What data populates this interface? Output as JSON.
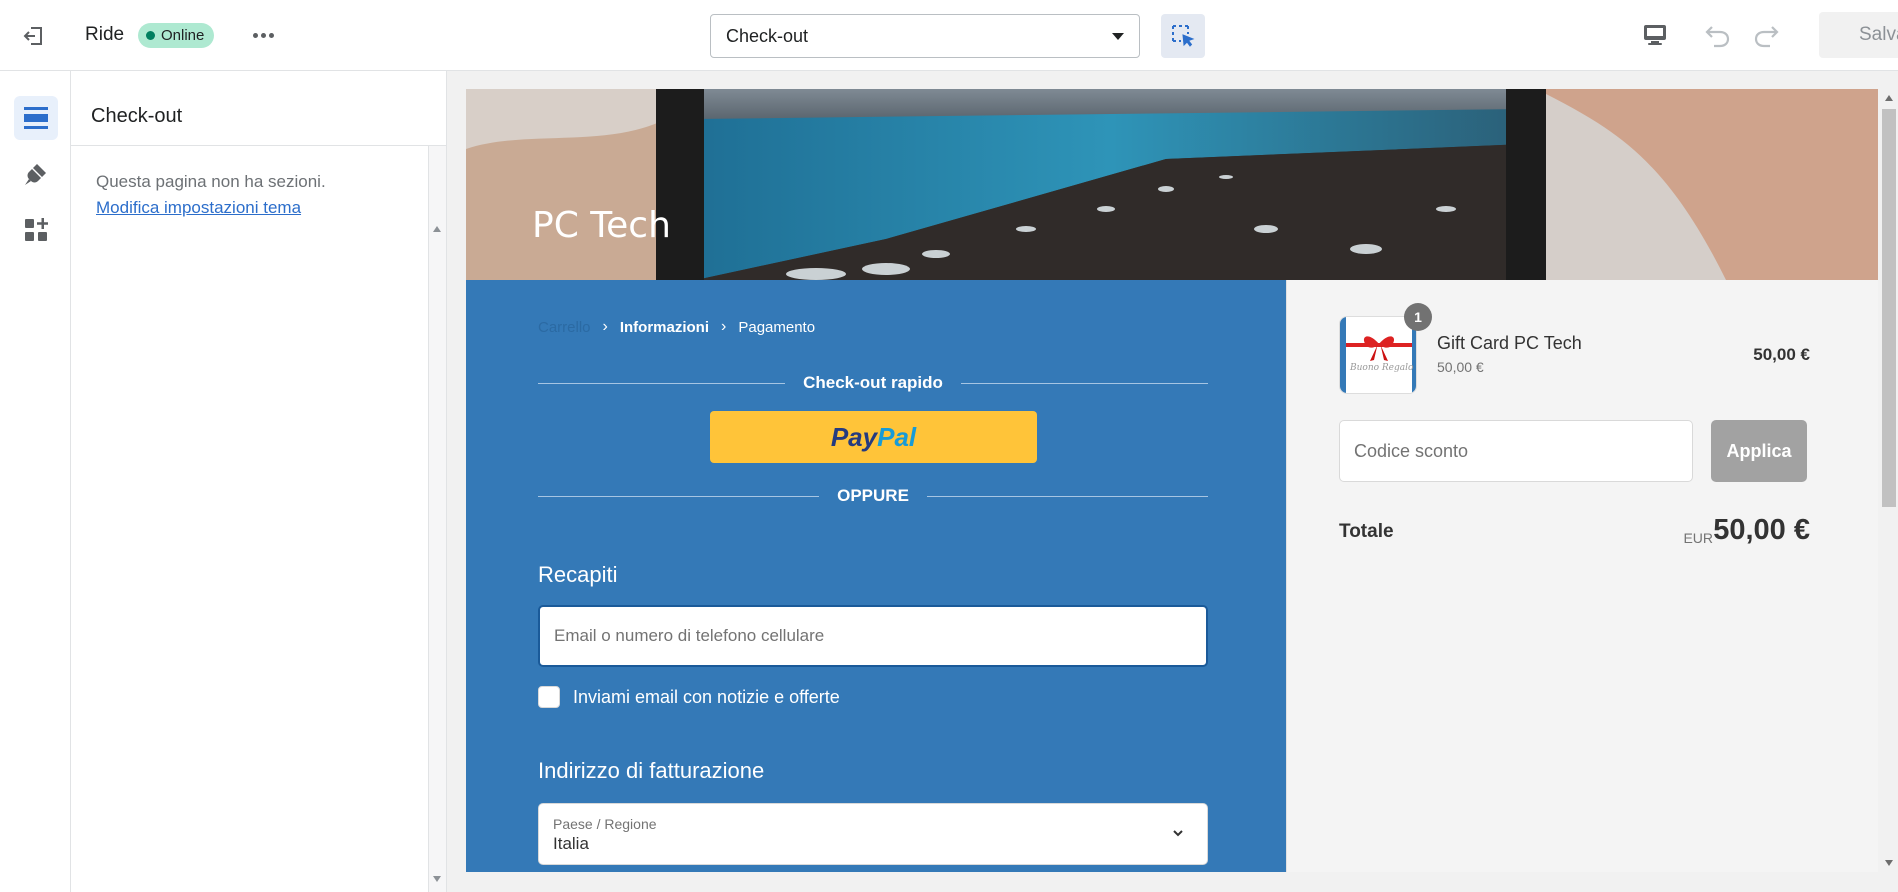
{
  "topbar": {
    "store_name": "Ride",
    "status_badge": "Online",
    "template_select": "Check-out",
    "save_label": "Salva"
  },
  "sidebar": {
    "title": "Check-out",
    "empty_message": "Questa pagina non ha sezioni.",
    "theme_settings_link": "Modifica impostazioni tema"
  },
  "preview": {
    "shop_name": "PC Tech",
    "breadcrumbs": [
      "Carrello",
      "Informazioni",
      "Pagamento"
    ],
    "express_checkout_title": "Check-out rapido",
    "paypal_label": {
      "pay": "Pay",
      "pal": "Pal"
    },
    "or_divider": "OPPURE",
    "contact_heading": "Recapiti",
    "email_placeholder": "Email o numero di telefono cellulare",
    "newsletter_label": "Inviami email con notizie e offerte",
    "billing_heading": "Indirizzo di fatturazione",
    "country_label": "Paese / Regione",
    "country_value": "Italia",
    "cart": {
      "item_quantity": "1",
      "item_name": "Gift Card PC Tech",
      "item_variant_price": "50,00 €",
      "item_price": "50,00 €",
      "thumb_text": "Buono Regalo",
      "discount_placeholder": "Codice sconto",
      "apply_label": "Applica",
      "total_label": "Totale",
      "total_currency": "EUR",
      "total_amount": "50,00 €"
    }
  },
  "colors": {
    "checkout_main_bg": "#3479b7",
    "badge_online_bg": "#aee9d1",
    "paypal_yellow": "#ffc439",
    "link_blue": "#2c6ecb"
  },
  "icons": [
    "exit-icon",
    "more-dots-icon",
    "dropdown-caret-icon",
    "inspect-icon",
    "desktop-icon",
    "undo-icon",
    "redo-icon",
    "sections-icon",
    "theme-brush-icon",
    "apps-icon",
    "chevron-right-icon",
    "chevron-down-icon"
  ]
}
